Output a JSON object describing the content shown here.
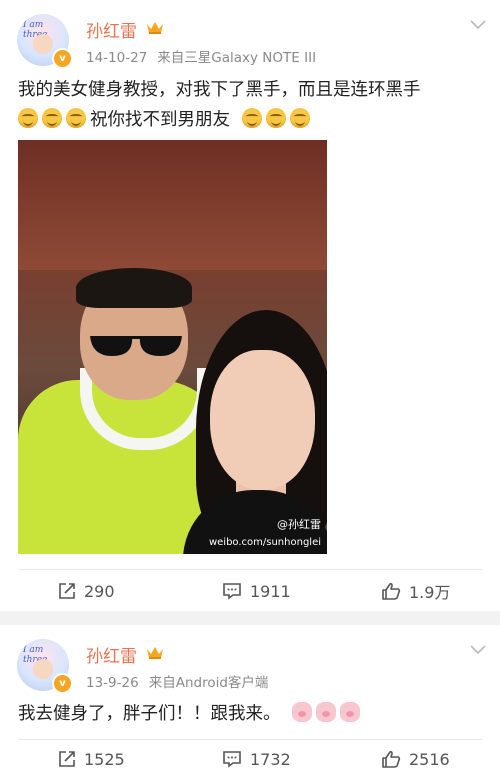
{
  "posts": [
    {
      "username": "孙红雷",
      "date": "14-10-27",
      "source": "来自三星Galaxy NOTE III",
      "text_line1": "我的美女健身教授，对我下了黑手，而且是连环黑手",
      "text_line2": "祝你找不到男朋友",
      "emoji_before": [
        "grin-emoji",
        "grin-emoji",
        "grin-emoji"
      ],
      "emoji_after": [
        "grin-emoji",
        "grin-emoji",
        "grin-emoji"
      ],
      "image": {
        "watermark_weibo": "@孙红雷",
        "watermark_url": "weibo.com/sunhonglei"
      },
      "actions": {
        "repost": "290",
        "comment": "1911",
        "like": "1.9万"
      }
    },
    {
      "username": "孙红雷",
      "date": "13-9-26",
      "source": "来自Android客户端",
      "text": "我去健身了，胖子们！！跟我来。",
      "emoji_after": [
        "pig-emoji",
        "pig-emoji",
        "pig-emoji"
      ],
      "actions": {
        "repost": "1525",
        "comment": "1732",
        "like": "2516"
      }
    }
  ],
  "avatar_text": "I am three",
  "colors": {
    "username": "#eb7350",
    "badge": "#f5a623",
    "meta": "#8a8a8a"
  }
}
